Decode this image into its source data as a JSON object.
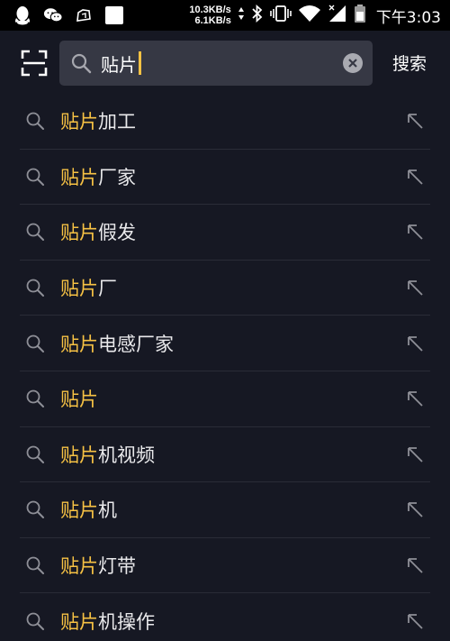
{
  "status_bar": {
    "icons": [
      "qq-icon",
      "wechat-icon",
      "app-icon",
      "blank-square-icon"
    ],
    "net_up": "10.3KB/s",
    "net_down": "6.1KB/s",
    "system_icons": [
      "bluetooth-icon",
      "vibrate-icon",
      "wifi-icon",
      "signal-icon",
      "battery-icon"
    ],
    "time": "下午3:03"
  },
  "search": {
    "query": "贴片",
    "action_label": "搜索"
  },
  "colors": {
    "background": "#161823",
    "highlight": "#f7c244",
    "search_box": "#363844"
  },
  "suggestions": [
    {
      "highlight": "贴片",
      "rest": "加工"
    },
    {
      "highlight": "贴片",
      "rest": "厂家"
    },
    {
      "highlight": "贴片",
      "rest": "假发"
    },
    {
      "highlight": "贴片",
      "rest": "厂"
    },
    {
      "highlight": "贴片",
      "rest": "电感厂家"
    },
    {
      "highlight": "贴片",
      "rest": ""
    },
    {
      "highlight": "贴片",
      "rest": "机视频"
    },
    {
      "highlight": "贴片",
      "rest": "机"
    },
    {
      "highlight": "贴片",
      "rest": "灯带"
    },
    {
      "highlight": "贴片",
      "rest": "机操作"
    }
  ]
}
